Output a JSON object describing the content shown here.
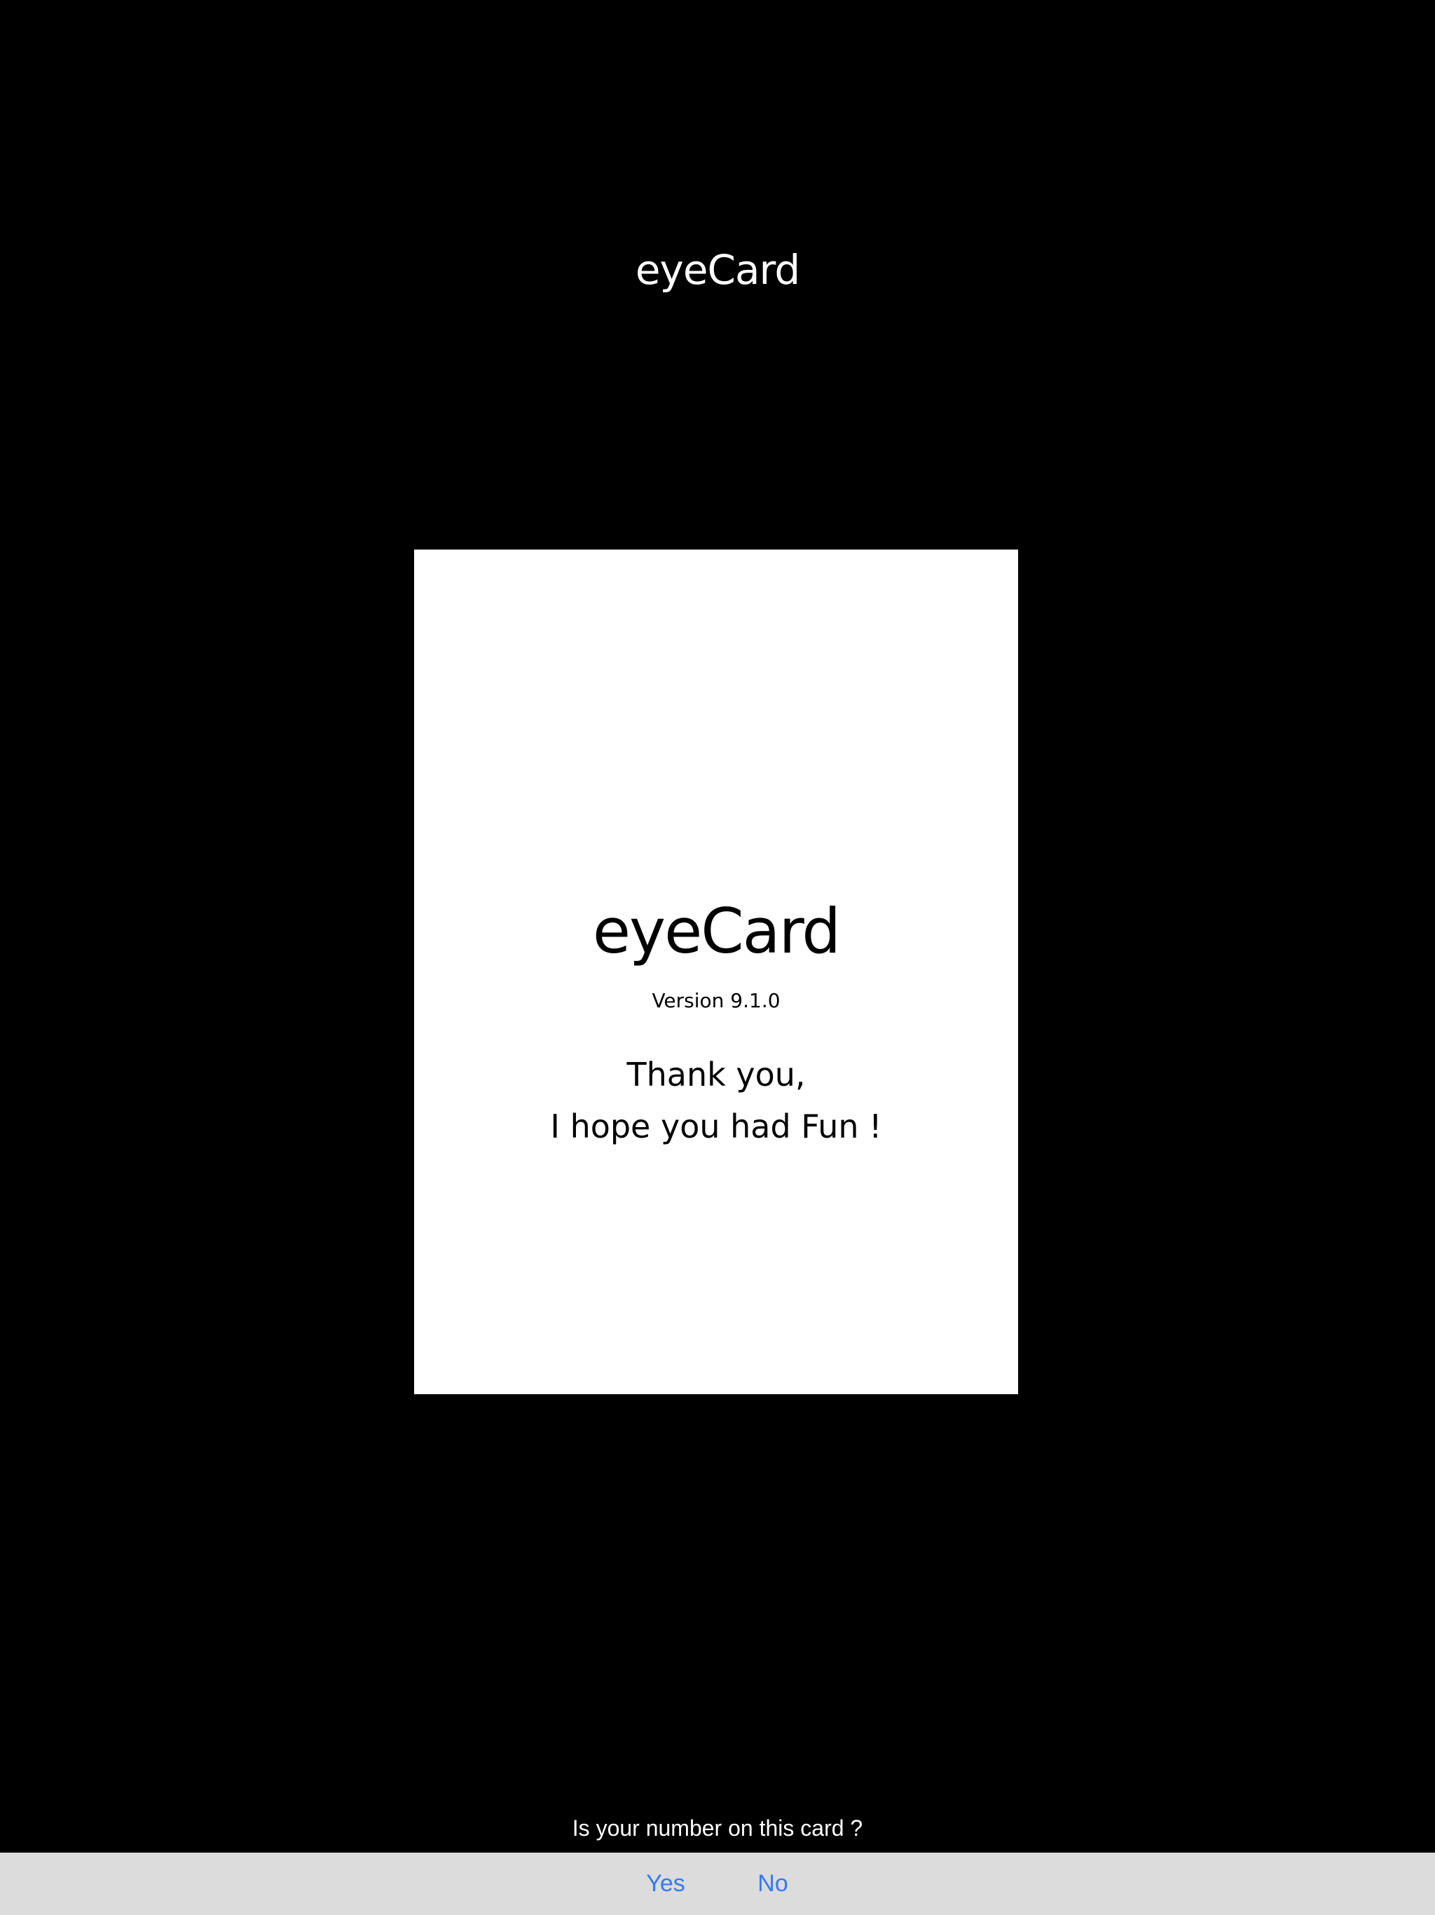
{
  "header": {
    "title": "eyeCard"
  },
  "card": {
    "title": "eyeCard",
    "version": "Version 9.1.0",
    "message_lines": [
      "Thank you,",
      "I hope you had Fun !"
    ]
  },
  "prompt": {
    "question": "Is your number on this card ?"
  },
  "toolbar": {
    "yes_label": "Yes",
    "no_label": "No"
  },
  "colors": {
    "background": "#000000",
    "card": "#ffffff",
    "toolbar": "#dcdcdc",
    "accent": "#3478f6"
  }
}
